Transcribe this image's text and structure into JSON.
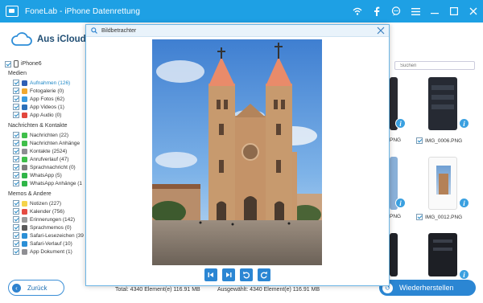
{
  "app": {
    "title": "FoneLab - iPhone Datenrettung",
    "brand": "#1ea0e4"
  },
  "titlebar_icons": [
    "wifi-icon",
    "facebook-icon",
    "chat-icon",
    "menu-icon",
    "minimize-icon",
    "restore-icon",
    "close-icon"
  ],
  "header": {
    "title": "Aus iCloud-B"
  },
  "device": {
    "label": "iPhone6"
  },
  "sidebar": {
    "groups": [
      {
        "title": "Medien",
        "items": [
          {
            "label": "Aufnahmen (126)",
            "icon": "camera-roll-icon",
            "color": "#2f5fb5",
            "active": true
          },
          {
            "label": "Fotogalerie (0)",
            "icon": "photo-library-icon",
            "color": "#f0a830"
          },
          {
            "label": "App Fotos (62)",
            "icon": "app-photos-icon",
            "color": "#3a9be0"
          },
          {
            "label": "App Videos (1)",
            "icon": "app-videos-icon",
            "color": "#2a6fb9"
          },
          {
            "label": "App Audio (0)",
            "icon": "app-audio-icon",
            "color": "#e2463d"
          }
        ]
      },
      {
        "title": "Nachrichten & Kontakte",
        "items": [
          {
            "label": "Nachrichten (22)",
            "icon": "messages-icon",
            "color": "#3fbf4a"
          },
          {
            "label": "Nachrichten Anhänge",
            "icon": "attachments-icon",
            "color": "#3fbf4a"
          },
          {
            "label": "Kontakte (2524)",
            "icon": "contacts-icon",
            "color": "#8e8e93"
          },
          {
            "label": "Anrufverlauf (47)",
            "icon": "call-history-icon",
            "color": "#3fbf4a"
          },
          {
            "label": "Sprachnachricht (0)",
            "icon": "voicemail-icon",
            "color": "#7d7d7d"
          },
          {
            "label": "WhatsApp (5)",
            "icon": "whatsapp-icon",
            "color": "#2fb548"
          },
          {
            "label": "WhatsApp Anhänge (1",
            "icon": "whatsapp-attach-icon",
            "color": "#2fb548"
          }
        ]
      },
      {
        "title": "Memos & Andere",
        "items": [
          {
            "label": "Notizen (227)",
            "icon": "notes-icon",
            "color": "#f5d34a"
          },
          {
            "label": "Kalender (756)",
            "icon": "calendar-icon",
            "color": "#e54b42"
          },
          {
            "label": "Erinnerungen (142)",
            "icon": "reminders-icon",
            "color": "#9a9a9a"
          },
          {
            "label": "Sprachmemos (0)",
            "icon": "voice-memos-icon",
            "color": "#5a5a5a"
          },
          {
            "label": "Safari-Lesezeichen (39",
            "icon": "safari-bookmarks-icon",
            "color": "#2b8fd6"
          },
          {
            "label": "Safari-Verlauf (10)",
            "icon": "safari-history-icon",
            "color": "#2b8fd6"
          },
          {
            "label": "App Dokument (1)",
            "icon": "app-document-icon",
            "color": "#8e8e93"
          }
        ]
      }
    ]
  },
  "search": {
    "placeholder": "Suchen"
  },
  "files": [
    {
      "name": "IMG_0006.PNG"
    },
    {
      "name": "IMG_0012.PNG"
    }
  ],
  "viewer": {
    "title": "Bildbetrachter",
    "controls": [
      "first-icon",
      "last-icon",
      "rotate-left-icon",
      "rotate-right-icon"
    ]
  },
  "footer": {
    "back_label": "Zurück",
    "total": "Total: 4340 Element(e) 116.91 MB",
    "selected": "Ausgewählt: 4340 Element(e) 116.91 MB",
    "recover_label": "Wiederherstellen"
  }
}
